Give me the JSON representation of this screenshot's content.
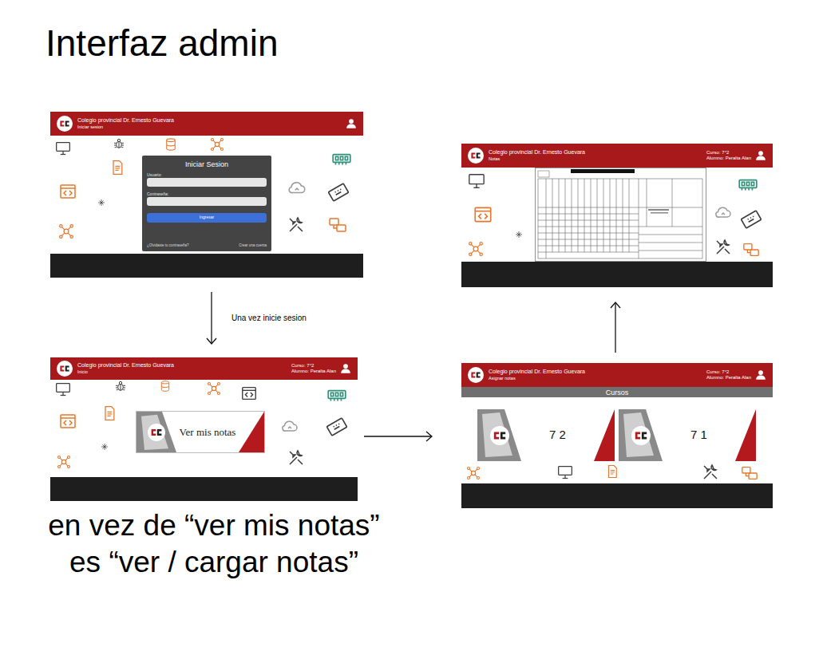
{
  "title": "Interfaz admin",
  "login_screen": {
    "header": {
      "school": "Colegio provincial Dr. Ernesto Guevara",
      "page": "Iniciar sesion"
    },
    "form": {
      "title": "Iniciar Sesion",
      "fields": [
        {
          "label": "Usuario:"
        },
        {
          "label": "Contraseña:"
        }
      ],
      "button": "Ingresar",
      "forgot": "¿Olvidaste tu contraseña?",
      "register": "Crear una cuenta"
    }
  },
  "flow_label": "Una vez inicie sesion",
  "home_screen": {
    "header": {
      "school": "Colegio provincial Dr. Ernesto Guevara",
      "page": "Inicio",
      "course": "Curso: 7°2",
      "student": "Alumno: Peralta Alan"
    },
    "card": {
      "label": "Ver mis notas"
    }
  },
  "note": "en vez de “ver mis notas” es “ver / cargar notas”",
  "courses_screen": {
    "header": {
      "school": "Colegio provincial Dr. Ernesto Guevara",
      "page": "Asignar notas",
      "course": "Curso: 7°2",
      "student": "Alumno: Peralta Alan"
    },
    "section_title": "Cursos",
    "courses": [
      {
        "label": "7 2"
      },
      {
        "label": "7 1"
      }
    ]
  },
  "grades_screen": {
    "header": {
      "school": "Colegio provincial Dr. Ernesto Guevara",
      "page": "Notas",
      "course": "Curso: 7°2",
      "student": "Alumno: Peralta Alan"
    }
  }
}
